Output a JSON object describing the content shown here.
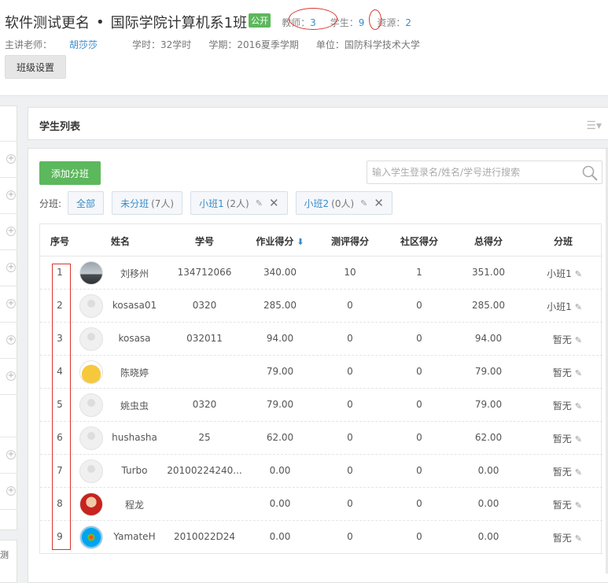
{
  "header": {
    "course": "软件测试更名",
    "separator": "•",
    "class_name": "国际学院计算机系1班",
    "public_badge": "公开",
    "teachers_label": "教师：",
    "teachers_count": "3",
    "students_label": "学生：",
    "students_count": "9",
    "resources_label": "资源：",
    "resources_count": "2",
    "lead_teacher_label": "主讲老师：",
    "lead_teacher": "胡莎莎",
    "hours": "学时：32学时",
    "term": "学期：2016夏季学期",
    "unit": "单位：国防科学技术大学",
    "settings_button": "班级设置"
  },
  "sidebar": {
    "bottom_text": "测"
  },
  "panel": {
    "title": "学生列表",
    "menu_icon": "list-icon",
    "add_group_button": "添加分班",
    "search_placeholder": "输入学生登录名/姓名/学号进行搜索",
    "group_label": "分班:",
    "groups": [
      {
        "name": "全部",
        "count": ""
      },
      {
        "name": "未分班",
        "count": "(7人)"
      },
      {
        "name": "小班1",
        "count": "(2人)"
      },
      {
        "name": "小班2",
        "count": "(0人)"
      }
    ]
  },
  "table": {
    "headers": [
      "序号",
      "姓名",
      "学号",
      "作业得分",
      "测评得分",
      "社区得分",
      "总得分",
      "分班"
    ],
    "sort_icon": "arrow-down-icon",
    "rows": [
      {
        "seq": "1",
        "avatar": "photo",
        "name": "刘移州",
        "id": "134712066",
        "homework": "340.00",
        "eval": "10",
        "community": "1",
        "total": "351.00",
        "group": "小班1"
      },
      {
        "seq": "2",
        "avatar": "default",
        "name": "kosasa01",
        "id": "0320",
        "homework": "285.00",
        "eval": "0",
        "community": "0",
        "total": "285.00",
        "group": "小班1"
      },
      {
        "seq": "3",
        "avatar": "default",
        "name": "kosasa",
        "id": "032011",
        "homework": "94.00",
        "eval": "0",
        "community": "0",
        "total": "94.00",
        "group": "暂无"
      },
      {
        "seq": "4",
        "avatar": "cartoon",
        "name": "陈晓婷",
        "id": "",
        "homework": "79.00",
        "eval": "0",
        "community": "0",
        "total": "79.00",
        "group": "暂无"
      },
      {
        "seq": "5",
        "avatar": "default",
        "name": "姚虫虫",
        "id": "0320",
        "homework": "79.00",
        "eval": "0",
        "community": "0",
        "total": "79.00",
        "group": "暂无"
      },
      {
        "seq": "6",
        "avatar": "default",
        "name": "hushasha",
        "id": "25",
        "homework": "62.00",
        "eval": "0",
        "community": "0",
        "total": "62.00",
        "group": "暂无"
      },
      {
        "seq": "7",
        "avatar": "default",
        "name": "Turbo",
        "id": "20100224240...",
        "homework": "0.00",
        "eval": "0",
        "community": "0",
        "total": "0.00",
        "group": "暂无"
      },
      {
        "seq": "8",
        "avatar": "red",
        "name": "程龙",
        "id": "",
        "homework": "0.00",
        "eval": "0",
        "community": "0",
        "total": "0.00",
        "group": "暂无"
      },
      {
        "seq": "9",
        "avatar": "windows",
        "name": "YamateH",
        "id": "2010022D24",
        "homework": "0.00",
        "eval": "0",
        "community": "0",
        "total": "0.00",
        "group": "暂无"
      }
    ]
  },
  "colors": {
    "accent": "#3a8cc8",
    "green": "#5cb85c",
    "annotation_red": "#d9342b"
  }
}
